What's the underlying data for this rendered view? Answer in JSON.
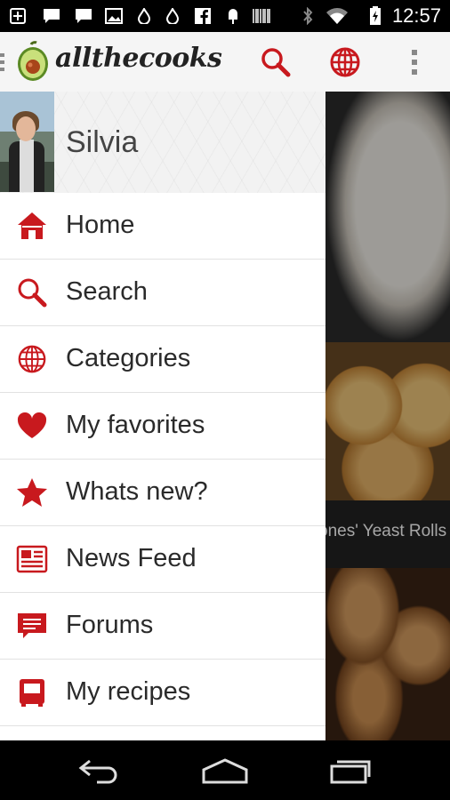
{
  "status_bar": {
    "time": "12:57",
    "icons": [
      "add-icon",
      "chat-icon",
      "chat-icon",
      "image-icon",
      "flame-icon",
      "flame-icon",
      "facebook-icon",
      "popsicle-icon",
      "barcode-icon",
      "bluetooth-icon",
      "wifi-icon",
      "battery-charging-icon"
    ]
  },
  "action_bar": {
    "app_name": "allthecooks",
    "actions": [
      "search-icon",
      "globe-icon",
      "overflow-menu-icon"
    ]
  },
  "profile": {
    "name": "Silvia"
  },
  "drawer": {
    "items": [
      {
        "label": "Home",
        "icon": "home-icon"
      },
      {
        "label": "Search",
        "icon": "search-icon"
      },
      {
        "label": "Categories",
        "icon": "globe-icon"
      },
      {
        "label": "My favorites",
        "icon": "heart-icon"
      },
      {
        "label": "Whats new?",
        "icon": "star-icon"
      },
      {
        "label": "News Feed",
        "icon": "newspaper-icon"
      },
      {
        "label": "Forums",
        "icon": "forum-icon"
      },
      {
        "label": "My recipes",
        "icon": "recipe-box-icon"
      }
    ]
  },
  "background_content": {
    "recipe_caption": "ones' Yeast Rolls"
  },
  "colors": {
    "accent": "#c8191e",
    "drawer_bg": "#ffffff",
    "action_bar_bg": "#f5f5f5"
  },
  "nav_bar": {
    "buttons": [
      "back-icon",
      "home-nav-icon",
      "recents-icon"
    ]
  }
}
